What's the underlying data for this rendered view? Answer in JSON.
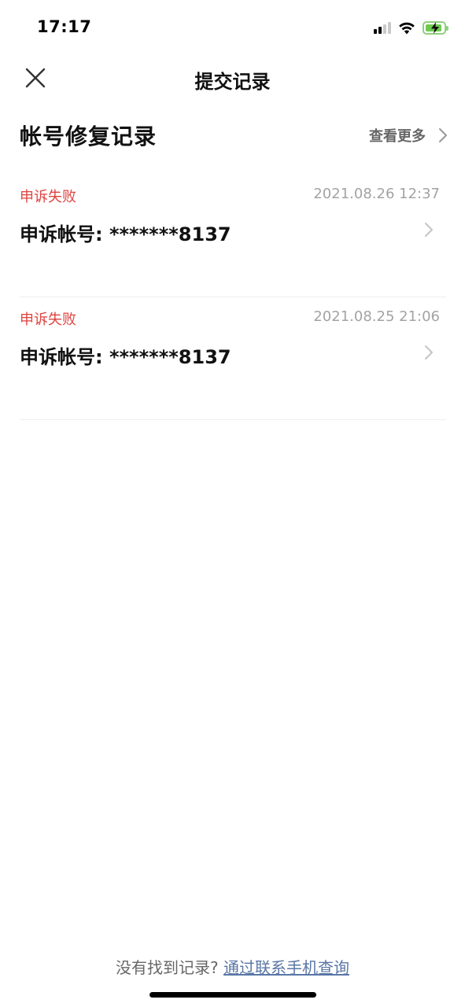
{
  "status_bar": {
    "time": "17:17",
    "icons": [
      "signal-icon",
      "wifi-icon",
      "battery-charging-icon"
    ]
  },
  "nav": {
    "title": "提交记录",
    "close_icon": "close-icon"
  },
  "section": {
    "title": "帐号修复记录",
    "view_more_label": "查看更多"
  },
  "records": [
    {
      "status": "申诉失败",
      "date": "2021.08.26 12:37",
      "account": "申诉帐号: *******8137"
    },
    {
      "status": "申诉失败",
      "date": "2021.08.25 21:06",
      "account": "申诉帐号: *******8137"
    }
  ],
  "footer": {
    "prompt": "没有找到记录?",
    "link": "通过联系手机查询"
  },
  "colors": {
    "status_failed": "#e0433f",
    "link": "#5a76a6",
    "muted": "#a3a3a3",
    "battery": "#6ecb4f"
  }
}
